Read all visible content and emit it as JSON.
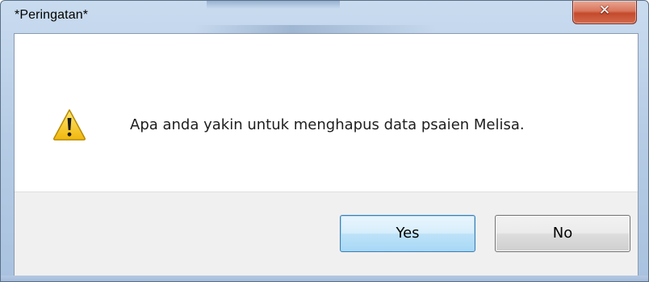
{
  "window": {
    "title": "*Peringatan*",
    "close_glyph": "✕"
  },
  "dialog": {
    "icon": "warning-icon",
    "message": "Apa anda yakin untuk menghapus data psaien Melisa."
  },
  "buttons": {
    "yes_label": "Yes",
    "no_label": "No"
  },
  "colors": {
    "frame": "#b7cde6",
    "close_button": "#c44a2c",
    "default_button_border": "#3c7fb1",
    "button_bar": "#f0f0f0",
    "warning_yellow": "#f6c518"
  }
}
